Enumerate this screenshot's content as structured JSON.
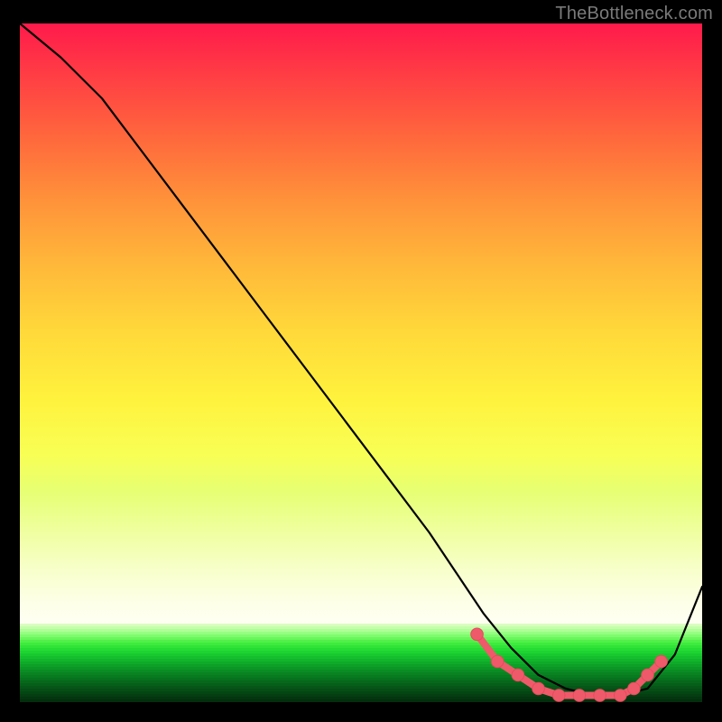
{
  "watermark": "TheBottleneck.com",
  "chart_data": {
    "type": "line",
    "title": "",
    "xlabel": "",
    "ylabel": "",
    "xlim": [
      0,
      100
    ],
    "ylim": [
      0,
      100
    ],
    "background": {
      "kind": "vertical-gradient",
      "top": "red",
      "mid": "yellow",
      "bottom": "green"
    },
    "series": [
      {
        "name": "bottleneck-curve",
        "color": "#000000",
        "x": [
          0,
          6,
          12,
          18,
          24,
          30,
          36,
          42,
          48,
          54,
          60,
          64,
          68,
          72,
          76,
          80,
          84,
          88,
          92,
          96,
          100
        ],
        "y": [
          100,
          95,
          89,
          81,
          73,
          65,
          57,
          49,
          41,
          33,
          25,
          19,
          13,
          8,
          4,
          2,
          1,
          1,
          2,
          7,
          17
        ]
      }
    ],
    "flat_region_x": [
      70,
      90
    ],
    "highlight_points": {
      "color": "#ef5a6a",
      "x": [
        67,
        70,
        73,
        76,
        79,
        82,
        85,
        88,
        90,
        92,
        94
      ],
      "y": [
        10,
        6,
        4,
        2,
        1,
        1,
        1,
        1,
        2,
        4,
        6
      ]
    }
  }
}
